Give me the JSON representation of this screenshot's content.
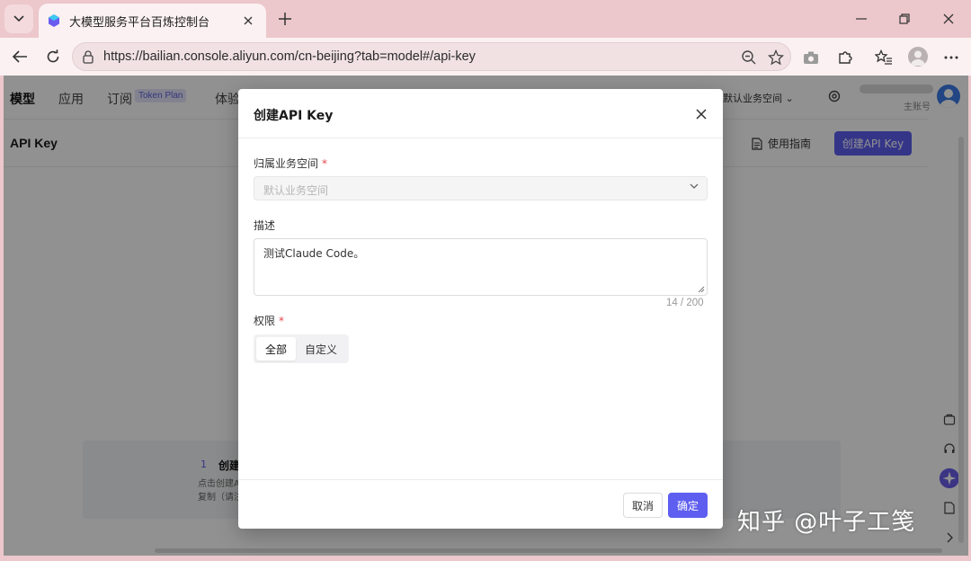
{
  "browser": {
    "tab_title": "大模型服务平台百炼控制台",
    "url": "https://bailian.console.aliyun.com/cn-beijing?tab=model#/api-key"
  },
  "topnav": {
    "items": [
      "模型",
      "应用",
      "订阅",
      "体验"
    ],
    "token_plan_badge": "Token Plan",
    "workspace": "默认业务空间",
    "account_label": "主账号"
  },
  "subheader": {
    "title": "API Key",
    "guide_label": "使用指南",
    "create_label": "创建API Key"
  },
  "step_card": {
    "number": "1",
    "title": "创建",
    "desc_line1": "点击创建A",
    "desc_line2": "复制（请注"
  },
  "modal": {
    "title": "创建API Key",
    "workspace_label": "归属业务空间",
    "workspace_placeholder": "默认业务空间",
    "description_label": "描述",
    "description_value": "测试Claude Code。",
    "char_count": "14 / 200",
    "permission_label": "权限",
    "permission_options": [
      "全部",
      "自定义"
    ],
    "cancel_label": "取消",
    "ok_label": "确定"
  },
  "watermark": "知乎 @叶子工笺",
  "colors": {
    "accent": "#5e5ef0",
    "required": "#e5484d"
  }
}
